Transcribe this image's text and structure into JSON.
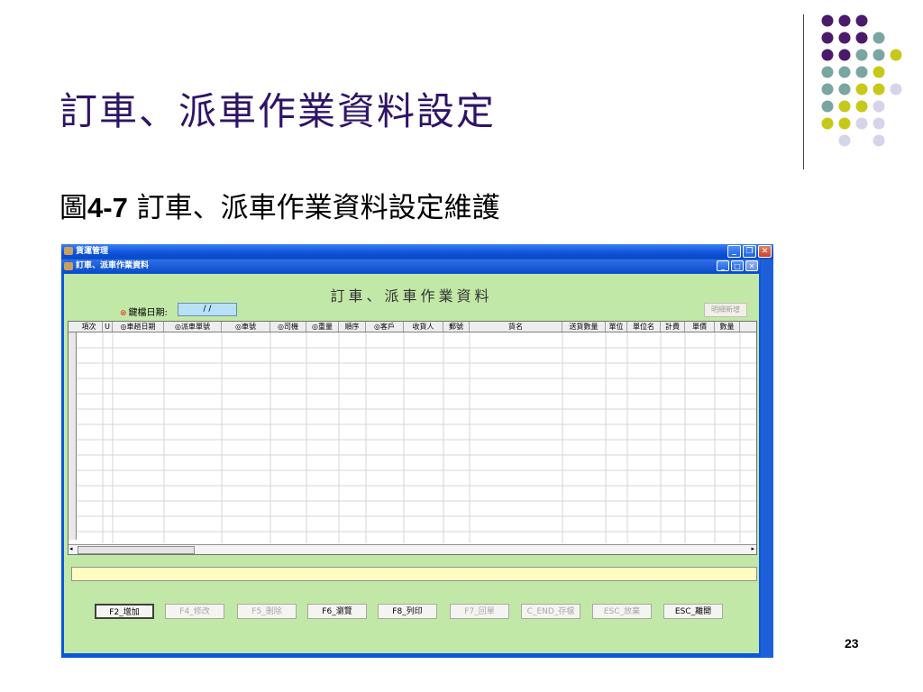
{
  "slide": {
    "title": "訂車、派車作業資料設定",
    "subtitle_prefix": "圖",
    "subtitle_number": "4-7",
    "subtitle_text": " 訂車、派車作業資料設定維護",
    "page_number": "23"
  },
  "window": {
    "title": "貨運管理",
    "child_title": "訂車、派車作業資料",
    "form_title": "訂車、派車作業資料",
    "date_label": "鍵檔日期:",
    "date_value": "/ /",
    "detail_button": "明細新增"
  },
  "table": {
    "columns": [
      "項次",
      "U",
      "◎車趟日期",
      "◎派車單號",
      "◎車號",
      "◎司機",
      "◎重量",
      "順序",
      "◎客戶",
      "收貨人",
      "郵號",
      "貨名",
      "送貨數量",
      "單位",
      "單位名",
      "計費",
      "單價",
      "數量"
    ]
  },
  "buttons": [
    {
      "label": "F2_增加",
      "state": "focused"
    },
    {
      "label": "F4_修改",
      "state": "disabled"
    },
    {
      "label": "F5_刪除",
      "state": "disabled"
    },
    {
      "label": "F6_瀏覽",
      "state": "enabled"
    },
    {
      "label": "F8_列印",
      "state": "enabled"
    },
    {
      "label": "F7_回單",
      "state": "disabled"
    },
    {
      "label": "C_END_存檔",
      "state": "disabled"
    },
    {
      "label": "ESC_放棄",
      "state": "disabled"
    },
    {
      "label": "ESC_離開",
      "state": "enabled"
    }
  ],
  "colors": {
    "title": "#2e1466",
    "panel": "#c2e8a8",
    "dot_purple": "#4b1a6b",
    "dot_teal": "#7aa6a2",
    "dot_yellow": "#c8c81a",
    "dot_lavender": "#d6d4ea"
  }
}
